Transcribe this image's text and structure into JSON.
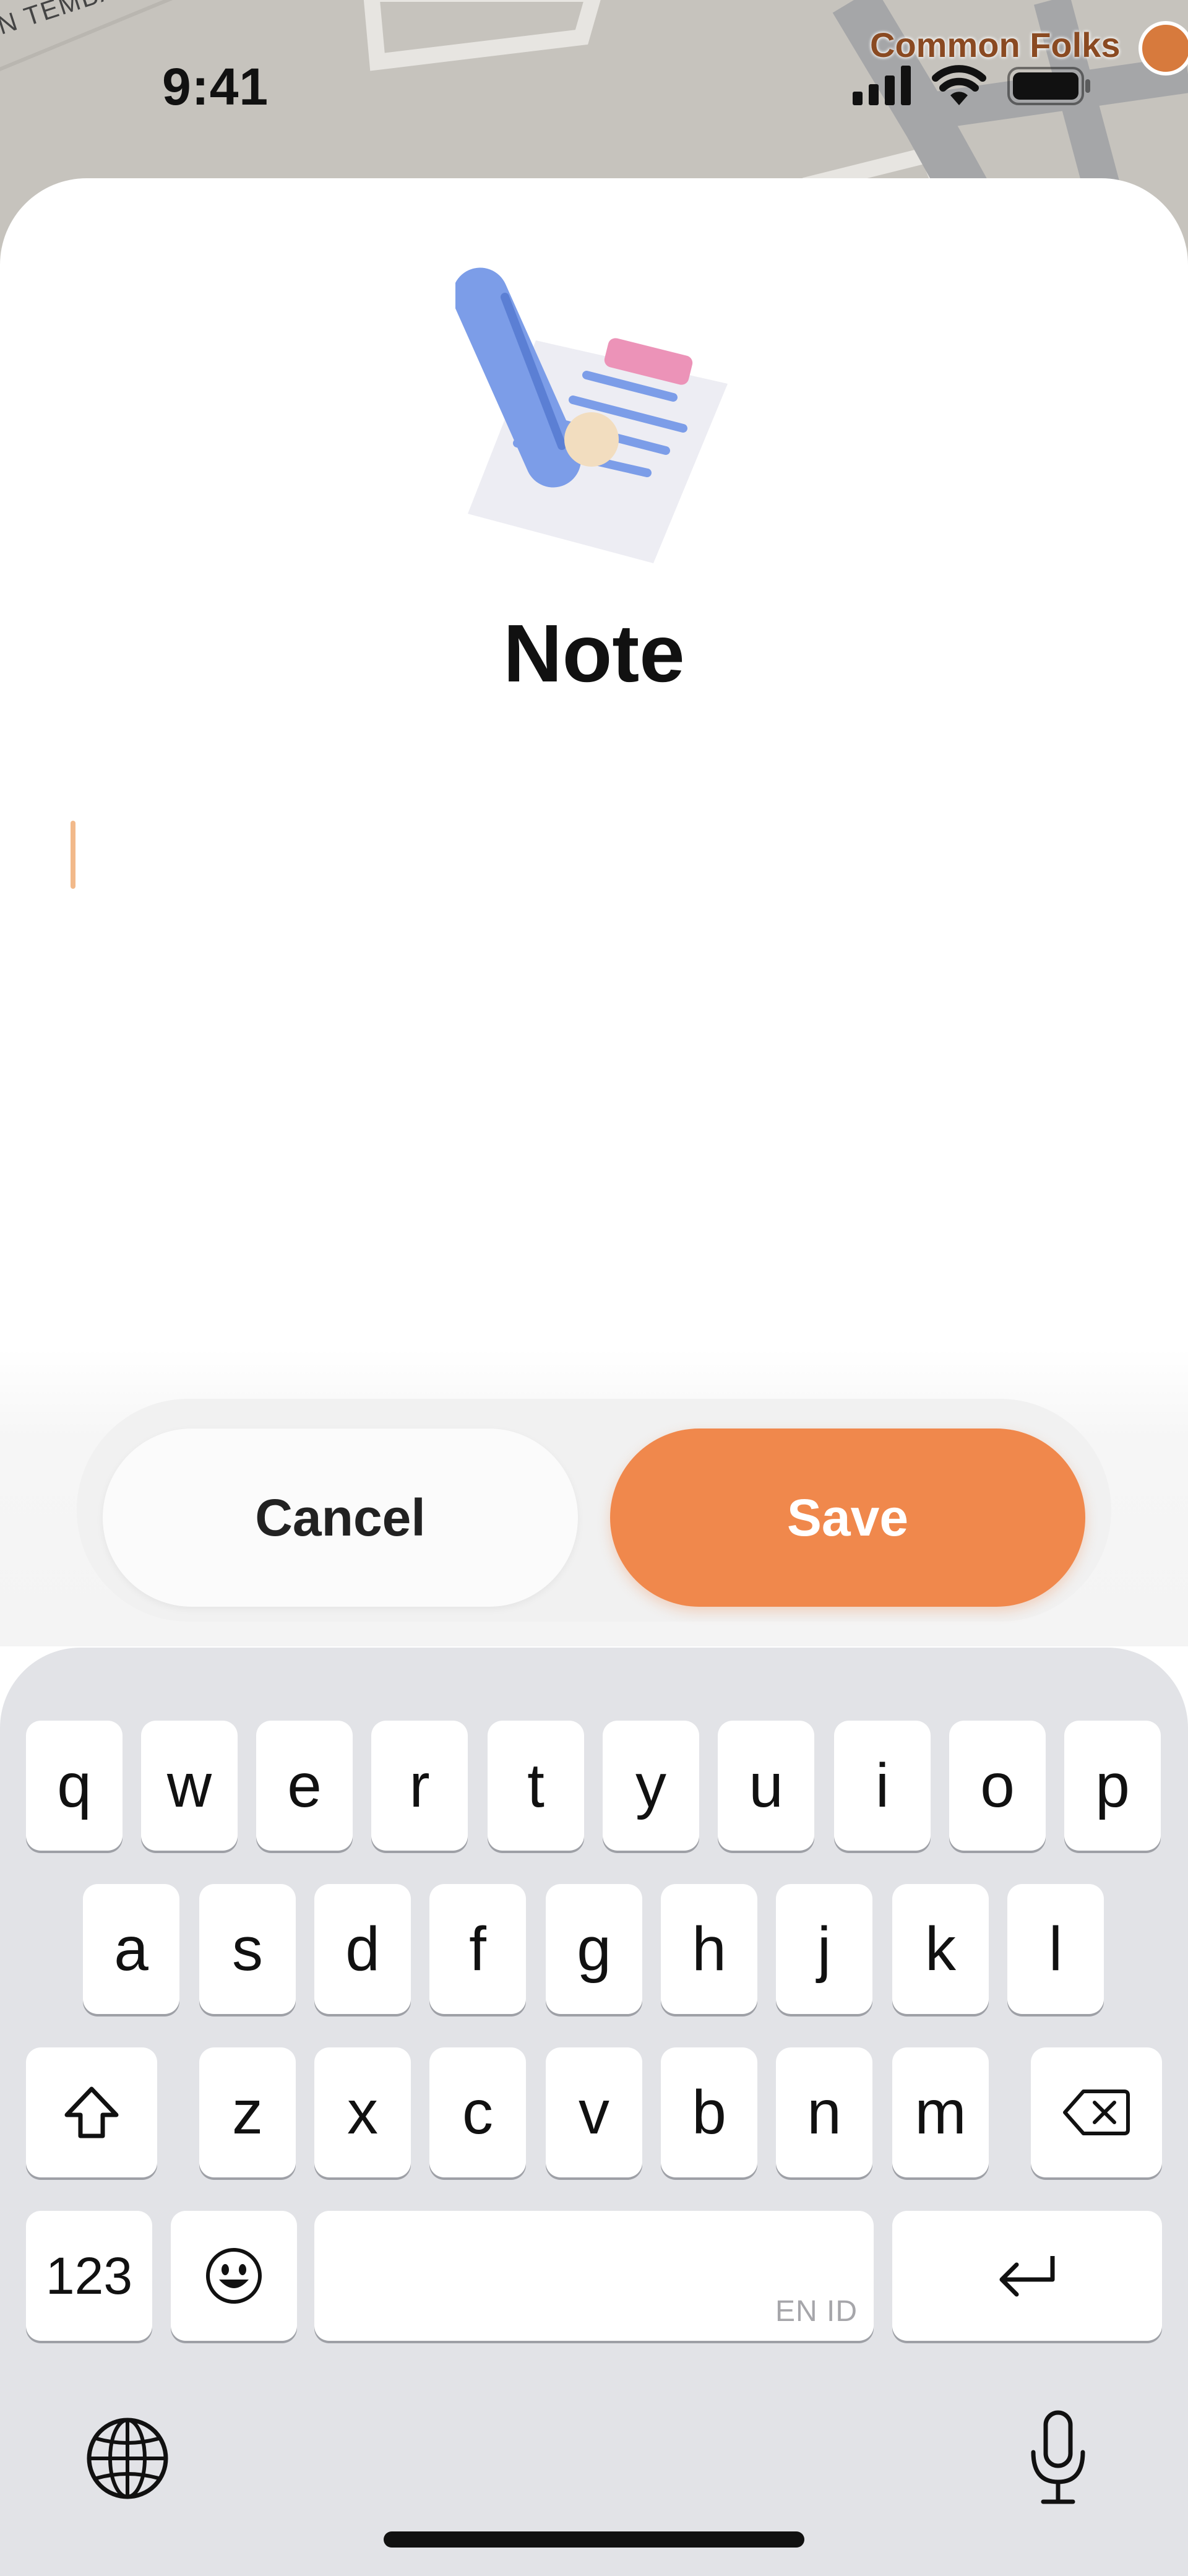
{
  "status_bar": {
    "time": "9:41"
  },
  "map": {
    "street_label": "N TEMBAKAU",
    "poi_label": "Common Folks"
  },
  "note_sheet": {
    "title": "Note",
    "cancel_label": "Cancel",
    "save_label": "Save",
    "accent_color": "#F0884C"
  },
  "keyboard": {
    "row1": [
      "q",
      "w",
      "e",
      "r",
      "t",
      "y",
      "u",
      "i",
      "o",
      "p"
    ],
    "row2": [
      "a",
      "s",
      "d",
      "f",
      "g",
      "h",
      "j",
      "k",
      "l"
    ],
    "row3": [
      "z",
      "x",
      "c",
      "v",
      "b",
      "n",
      "m"
    ],
    "numbers_label": "123",
    "space_hint": "EN ID"
  }
}
